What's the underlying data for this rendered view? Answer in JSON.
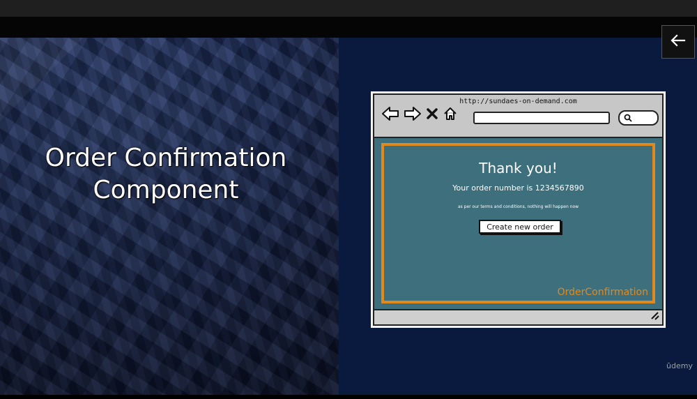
{
  "slide": {
    "title_line1": "Order Confirmation",
    "title_line2": "Component"
  },
  "controls": {
    "back_icon": "arrow-left-icon"
  },
  "mockup": {
    "url": "http://sundaes-on-demand.com",
    "nav_icons": [
      "back-arrow-icon",
      "forward-arrow-icon",
      "close-x-icon",
      "home-icon"
    ],
    "search_icon": "search-icon",
    "heading": "Thank you!",
    "order_text": "Your order number is 1234567890",
    "terms_text": "as per our terms and conditions, nothing will happen now",
    "button_label": "Create new order",
    "component_label": "OrderConfirmation",
    "colors": {
      "content_bg": "#3e6f7d",
      "frame": "#e08a1e",
      "chrome": "#c7c7c7"
    }
  },
  "watermark": "ūdemy"
}
